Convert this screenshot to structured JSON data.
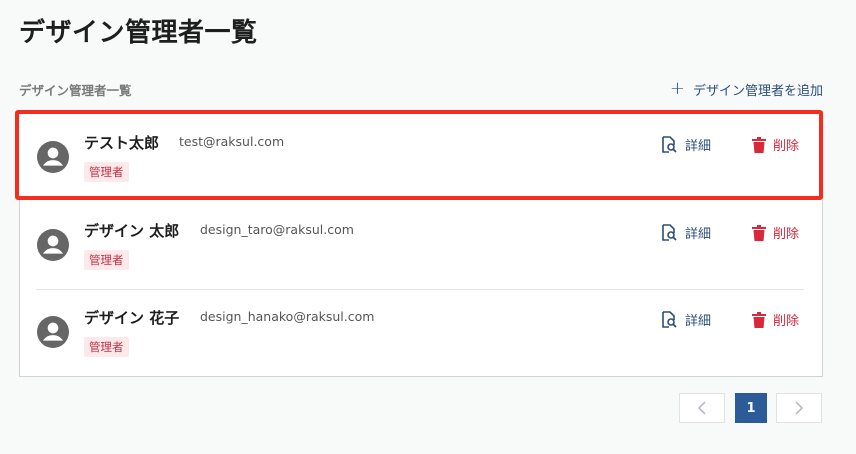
{
  "page": {
    "title": "デザイン管理者一覧"
  },
  "section": {
    "title": "デザイン管理者一覧",
    "add_label": "デザイン管理者を追加"
  },
  "admins": [
    {
      "name": "テスト太郎",
      "email": "test@raksul.com",
      "role": "管理者",
      "detail_label": "詳細",
      "delete_label": "削除"
    },
    {
      "name": "デザイン 太郎",
      "email": "design_taro@raksul.com",
      "role": "管理者",
      "detail_label": "詳細",
      "delete_label": "削除"
    },
    {
      "name": "デザイン 花子",
      "email": "design_hanako@raksul.com",
      "role": "管理者",
      "detail_label": "詳細",
      "delete_label": "削除"
    }
  ],
  "pagination": {
    "current_page": "1"
  },
  "colors": {
    "accent": "#2c5c97",
    "link": "#2b4f7a",
    "danger": "#d8283a",
    "highlight": "#f42d1e",
    "badge_bg": "#fde8ea"
  },
  "icons": {
    "avatar": "user-circle-icon",
    "detail": "document-search-icon",
    "delete": "trash-icon",
    "prev": "chevron-left-icon",
    "next": "chevron-right-icon",
    "add": "plus-icon"
  }
}
